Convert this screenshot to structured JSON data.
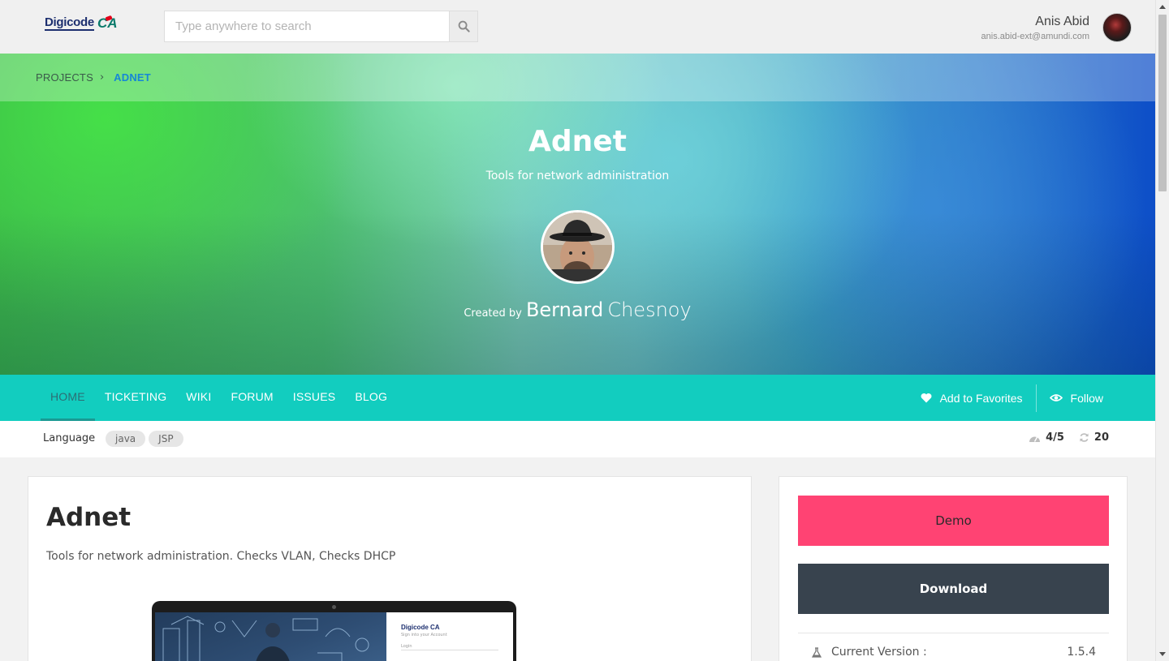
{
  "header": {
    "logo_text": "Digicode",
    "logo_mark": "CA",
    "search_placeholder": "Type anywhere to search",
    "search_icon": "search-icon",
    "user": {
      "name": "Anis Abid",
      "email": "anis.abid-ext@amundi.com"
    }
  },
  "breadcrumb": {
    "root": "PROJECTS",
    "separator": "›",
    "current": "ADNET"
  },
  "hero": {
    "title": "Adnet",
    "subtitle": "Tools for network administration",
    "created_by_label": "Created by",
    "creator_first": "Bernard",
    "creator_last": "Chesnoy"
  },
  "nav": {
    "tabs": [
      {
        "label": "HOME",
        "active": true
      },
      {
        "label": "TICKETING",
        "active": false
      },
      {
        "label": "WIKI",
        "active": false
      },
      {
        "label": "FORUM",
        "active": false
      },
      {
        "label": "ISSUES",
        "active": false
      },
      {
        "label": "BLOG",
        "active": false
      }
    ],
    "favorites_label": "Add to Favorites",
    "favorites_icon": "heart-icon",
    "follow_label": "Follow",
    "follow_icon": "eye-icon",
    "accent_color": "#12cdbf"
  },
  "language": {
    "label": "Language",
    "tags": [
      "java",
      "JSP"
    ],
    "rating": "4/5",
    "rating_icon": "dashboard-icon",
    "reuse_count": "20",
    "reuse_icon": "refresh-icon"
  },
  "project": {
    "title": "Adnet",
    "description": "Tools for network administration. Checks VLAN, Checks DHCP",
    "screenshot": {
      "logo": "Digicode CA",
      "tagline": "Sign into your Account",
      "field_label": "Login"
    }
  },
  "sidebar": {
    "demo_label": "Demo",
    "demo_color": "#ff4373",
    "download_label": "Download",
    "download_color": "#38434e",
    "version_label": "Current Version :",
    "version_value": "1.5.4",
    "version_icon": "flask-icon"
  }
}
